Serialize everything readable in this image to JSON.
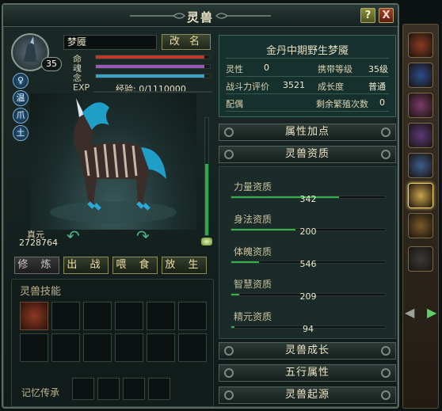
{
  "window": {
    "title": "灵兽",
    "help_label": "?",
    "close_label": "X"
  },
  "pet": {
    "level": "35",
    "name": "梦魇",
    "rename_label": "改 名",
    "stats": [
      {
        "label": "命",
        "color": "#c0392b",
        "fill": 0.95
      },
      {
        "label": "魂",
        "color": "#9b59b6",
        "fill": 0.95
      },
      {
        "label": "念",
        "color": "#3fa0c8",
        "fill": 0.95
      }
    ],
    "exp_label": "EXP",
    "exp_text": "经验: 0/1110000",
    "side_icons": [
      "♀",
      "温",
      "爪",
      "土"
    ],
    "zhenyuan_label": "真元",
    "zhenyuan_value": "2728764"
  },
  "actions": [
    {
      "label": "修 炼",
      "disabled": true
    },
    {
      "label": "出 战",
      "disabled": false
    },
    {
      "label": "喂 食",
      "disabled": false
    },
    {
      "label": "放 生",
      "disabled": false
    }
  ],
  "skills": {
    "title": "灵兽技能",
    "memory_label": "记忆传承"
  },
  "info": {
    "title": "金丹中期野生梦魇",
    "rows": [
      {
        "k1": "灵性",
        "v1": "0",
        "k2": "携带等级",
        "v2": "35级"
      },
      {
        "k1": "战斗力评价",
        "v1": "3521",
        "k2": "成长度",
        "v2": "普通"
      },
      {
        "k1": "配偶",
        "v1": "",
        "k2": "剩余繁殖次数",
        "v2": "0"
      }
    ]
  },
  "sections": {
    "attr_points": "属性加点",
    "aptitude": "灵兽资质",
    "growth": "灵兽成长",
    "elements": "五行属性",
    "origin": "灵兽起源"
  },
  "aptitudes": [
    {
      "label": "力量资质",
      "value": "342",
      "fill": 0.7
    },
    {
      "label": "身法资质",
      "value": "200",
      "fill": 0.42
    },
    {
      "label": "体魄资质",
      "value": "546",
      "fill": 0.18
    },
    {
      "label": "智慧资质",
      "value": "209",
      "fill": 0.05
    },
    {
      "label": "精元资质",
      "value": "94",
      "fill": 0.02
    }
  ],
  "strip_colors": [
    "#8a3b22",
    "#2b4c8a",
    "#7a3a6a",
    "#5a3a7a",
    "#3d5d8a",
    "#c9a34b",
    "#7a5a2a",
    "#3a3a3a"
  ]
}
